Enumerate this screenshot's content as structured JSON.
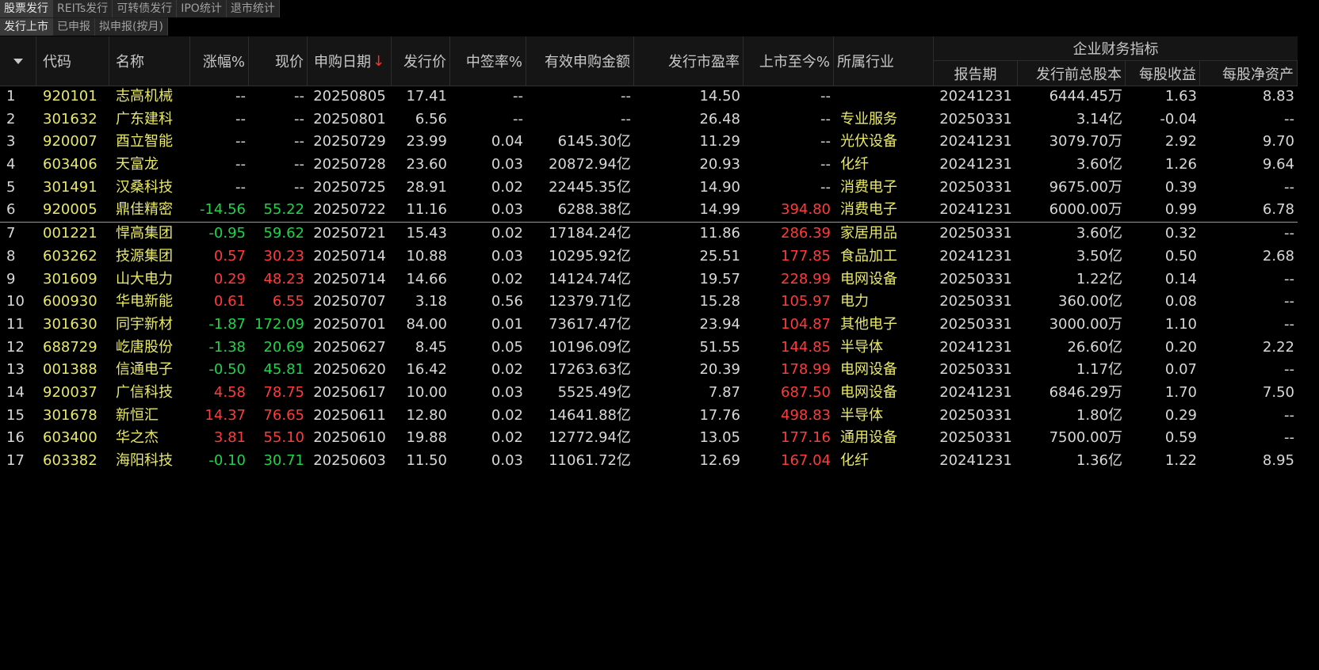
{
  "tabs_top": [
    "股票发行",
    "REITs发行",
    "可转债发行",
    "IPO统计",
    "退市统计"
  ],
  "tabs_sub": [
    "发行上市",
    "已申报",
    "拟申报(按月)"
  ],
  "header": {
    "code": "代码",
    "name": "名称",
    "change_pct": "涨幅%",
    "price": "现价",
    "sub_date": "申购日期",
    "sort_arrow": "↓",
    "issue_price": "发行价",
    "win_rate": "中签率%",
    "valid_amount": "有效申购金额",
    "issue_pe": "发行市盈率",
    "since_listing": "上市至今%",
    "industry": "所属行业",
    "fin_group": "企业财务指标",
    "report_period": "报告期",
    "pre_shares": "发行前总股本",
    "eps": "每股收益",
    "bps": "每股净资产"
  },
  "rows": [
    [
      "1",
      "920101",
      "志高机械",
      "--",
      "--",
      "20250805",
      "17.41",
      "--",
      "--",
      "14.50",
      "--",
      "",
      "20241231",
      "6444.45万",
      "1.63",
      "8.83"
    ],
    [
      "2",
      "301632",
      "广东建科",
      "--",
      "--",
      "20250801",
      "6.56",
      "--",
      "--",
      "26.48",
      "--",
      "专业服务",
      "20250331",
      "3.14亿",
      "-0.04",
      "--"
    ],
    [
      "3",
      "920007",
      "酉立智能",
      "--",
      "--",
      "20250729",
      "23.99",
      "0.04",
      "6145.30亿",
      "11.29",
      "--",
      "光伏设备",
      "20241231",
      "3079.70万",
      "2.92",
      "9.70"
    ],
    [
      "4",
      "603406",
      "天富龙",
      "--",
      "--",
      "20250728",
      "23.60",
      "0.03",
      "20872.94亿",
      "20.93",
      "--",
      "化纤",
      "20241231",
      "3.60亿",
      "1.26",
      "9.64"
    ],
    [
      "5",
      "301491",
      "汉桑科技",
      "--",
      "--",
      "20250725",
      "28.91",
      "0.02",
      "22445.35亿",
      "14.90",
      "--",
      "消费电子",
      "20250331",
      "9675.00万",
      "0.39",
      "--"
    ],
    [
      "6",
      "920005",
      "鼎佳精密",
      "-14.56",
      "55.22",
      "20250722",
      "11.16",
      "0.03",
      "6288.38亿",
      "14.99",
      "394.80",
      "消费电子",
      "20241231",
      "6000.00万",
      "0.99",
      "6.78"
    ],
    [
      "7",
      "001221",
      "悍高集团",
      "-0.95",
      "59.62",
      "20250721",
      "15.43",
      "0.02",
      "17184.24亿",
      "11.86",
      "286.39",
      "家居用品",
      "20250331",
      "3.60亿",
      "0.32",
      "--"
    ],
    [
      "8",
      "603262",
      "技源集团",
      "0.57",
      "30.23",
      "20250714",
      "10.88",
      "0.03",
      "10295.92亿",
      "25.51",
      "177.85",
      "食品加工",
      "20241231",
      "3.50亿",
      "0.50",
      "2.68"
    ],
    [
      "9",
      "301609",
      "山大电力",
      "0.29",
      "48.23",
      "20250714",
      "14.66",
      "0.02",
      "14124.74亿",
      "19.57",
      "228.99",
      "电网设备",
      "20250331",
      "1.22亿",
      "0.14",
      "--"
    ],
    [
      "10",
      "600930",
      "华电新能",
      "0.61",
      "6.55",
      "20250707",
      "3.18",
      "0.56",
      "12379.71亿",
      "15.28",
      "105.97",
      "电力",
      "20250331",
      "360.00亿",
      "0.08",
      "--"
    ],
    [
      "11",
      "301630",
      "同宇新材",
      "-1.87",
      "172.09",
      "20250701",
      "84.00",
      "0.01",
      "73617.47亿",
      "23.94",
      "104.87",
      "其他电子",
      "20250331",
      "3000.00万",
      "1.10",
      "--"
    ],
    [
      "12",
      "688729",
      "屹唐股份",
      "-1.38",
      "20.69",
      "20250627",
      "8.45",
      "0.05",
      "10196.09亿",
      "51.55",
      "144.85",
      "半导体",
      "20241231",
      "26.60亿",
      "0.20",
      "2.22"
    ],
    [
      "13",
      "001388",
      "信通电子",
      "-0.50",
      "45.81",
      "20250620",
      "16.42",
      "0.02",
      "17263.63亿",
      "20.39",
      "178.99",
      "电网设备",
      "20250331",
      "1.17亿",
      "0.07",
      "--"
    ],
    [
      "14",
      "920037",
      "广信科技",
      "4.58",
      "78.75",
      "20250617",
      "10.00",
      "0.03",
      "5525.49亿",
      "7.87",
      "687.50",
      "电网设备",
      "20241231",
      "6846.29万",
      "1.70",
      "7.50"
    ],
    [
      "15",
      "301678",
      "新恒汇",
      "14.37",
      "76.65",
      "20250611",
      "12.80",
      "0.02",
      "14641.88亿",
      "17.76",
      "498.83",
      "半导体",
      "20250331",
      "1.80亿",
      "0.29",
      "--"
    ],
    [
      "16",
      "603400",
      "华之杰",
      "3.81",
      "55.10",
      "20250610",
      "19.88",
      "0.02",
      "12772.94亿",
      "13.05",
      "177.16",
      "通用设备",
      "20250331",
      "7500.00万",
      "0.59",
      "--"
    ],
    [
      "17",
      "603382",
      "海阳科技",
      "-0.10",
      "30.71",
      "20250603",
      "11.50",
      "0.03",
      "11061.72亿",
      "12.69",
      "167.04",
      "化纤",
      "20241231",
      "1.36亿",
      "1.22",
      "8.95"
    ]
  ],
  "colors": {
    "up": "#ff3b3b",
    "down": "#1fd34a",
    "code_name": "#e8e86a",
    "text": "#d8d8d8"
  }
}
